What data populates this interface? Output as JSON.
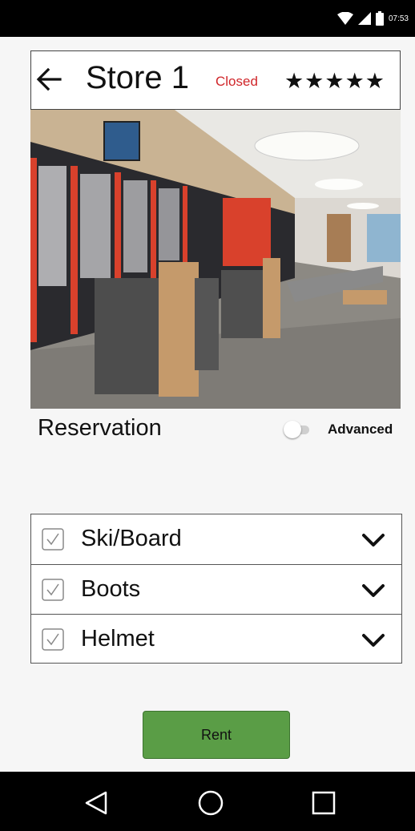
{
  "status_bar": {
    "time": "07:53",
    "icons": [
      "wifi-icon",
      "cellular-signal-icon",
      "battery-icon"
    ]
  },
  "header": {
    "title": "Store 1",
    "status": "Closed",
    "status_color": "#d0262a",
    "rating_display": "★★★★★",
    "rating": 5,
    "icons": [
      "arrow-left-icon"
    ]
  },
  "reservation": {
    "title": "Reservation",
    "advanced_toggle": {
      "label": "Advanced",
      "on": false
    }
  },
  "equipment": [
    {
      "label": "Ski/Board",
      "checked": true,
      "icon": "chevron-down-icon"
    },
    {
      "label": "Boots",
      "checked": true,
      "icon": "chevron-down-icon"
    },
    {
      "label": "Helmet",
      "checked": true,
      "icon": "chevron-down-icon"
    }
  ],
  "rent_button": {
    "label": "Rent",
    "color": "#5a9d46"
  },
  "nav_bar": {
    "icons": [
      "nav-back-icon",
      "nav-home-icon",
      "nav-recents-icon"
    ]
  }
}
